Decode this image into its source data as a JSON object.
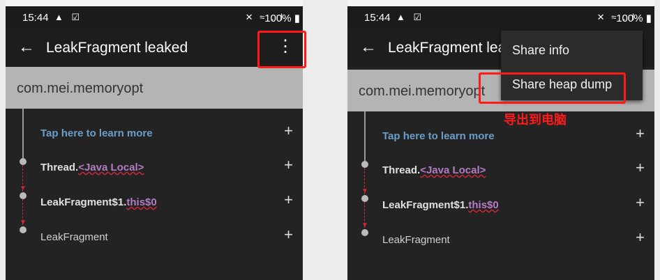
{
  "status": {
    "time": "15:44",
    "battery": "100%",
    "left_icons": "▲ ☑",
    "right_icons": "✕ ≈ .ıl"
  },
  "leak": {
    "title": "LeakFragment leaked",
    "package": "com.mei.memoryopt",
    "learn": "Tap here to learn more",
    "row1_prefix": "Thread.",
    "row1_field": "<Java Local>",
    "row2_prefix": "LeakFragment$1.",
    "row2_field": "this$0",
    "row3": "LeakFragment"
  },
  "menu": {
    "share_info": "Share info",
    "share_heap": "Share heap dump"
  },
  "annotation": "导出到电脑",
  "icons": {
    "back": "arrow-back-icon",
    "overflow": "more-vert-icon",
    "expand": "plus-icon"
  },
  "colors": {
    "highlight": "#ff1a1a",
    "link": "#6a9ec9",
    "field": "#b37cc3"
  }
}
